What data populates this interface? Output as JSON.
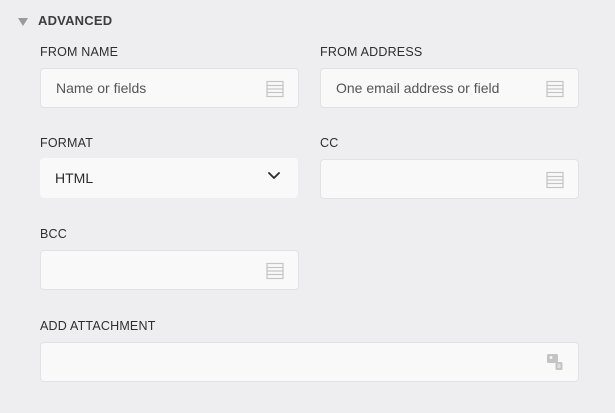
{
  "section": {
    "title": "ADVANCED"
  },
  "fields": {
    "from_name": {
      "label": "FROM NAME",
      "placeholder": "Name or fields",
      "icon": "list-icon"
    },
    "from_address": {
      "label": "FROM ADDRESS",
      "placeholder": "One email address or field",
      "icon": "list-icon"
    },
    "format": {
      "label": "FORMAT",
      "value": "HTML",
      "icon": "chevron-down-icon"
    },
    "cc": {
      "label": "CC",
      "placeholder": "",
      "icon": "list-icon"
    },
    "bcc": {
      "label": "BCC",
      "placeholder": "",
      "icon": "list-icon"
    },
    "attachment": {
      "label": "ADD ATTACHMENT",
      "placeholder": "",
      "icon": "attachment-image-icon"
    }
  },
  "colors": {
    "background": "#eeeef0",
    "field_background": "#f9f9f9",
    "icon": "#c4c4c4"
  }
}
